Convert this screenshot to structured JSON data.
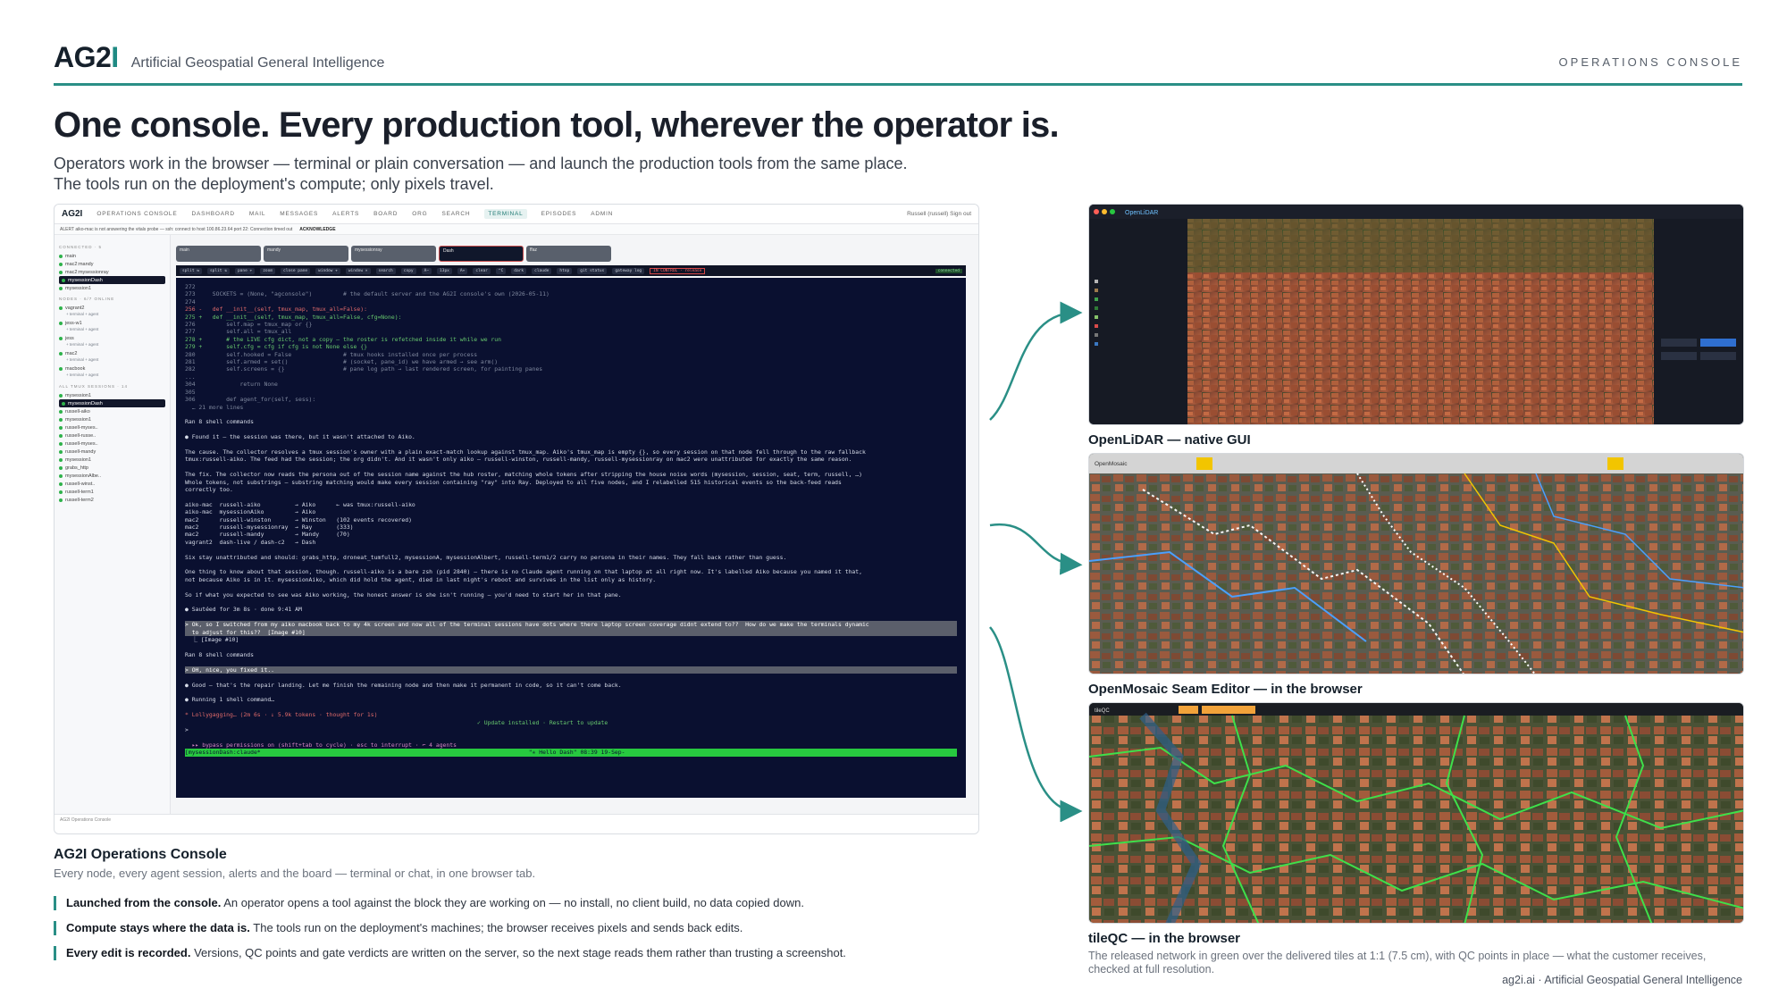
{
  "brand": {
    "logo_main": "AG2",
    "logo_accent": "I",
    "tagline": "Artificial Geospatial General Intelligence",
    "section": "OPERATIONS CONSOLE"
  },
  "headline": "One console. Every production tool, wherever the operator is.",
  "subhead": "Operators work in the browser — terminal or plain conversation — and launch the production tools from the same place. The tools run on the deployment's compute; only pixels travel.",
  "console": {
    "logo": "AG2I",
    "subtitle": "OPERATIONS CONSOLE",
    "nav": [
      "DASHBOARD",
      "MAIL",
      "MESSAGES",
      "ALERTS",
      "BOARD",
      "ORG",
      "SEARCH",
      "TERMINAL",
      "EPISODES",
      "ADMIN"
    ],
    "alert": "ALERT aiko-mac is not answering the vitals probe — ssh: connect to host 100.86.23.64 port 22: Connection timed out",
    "acknowledge": "ACKNOWLEDGE",
    "user": "Russell (russell)  Sign out",
    "sidebar_header": "CONNECTED · 5",
    "sidebar_items": [
      "main",
      "mac2:mandy",
      "mac2:mysessionray",
      "mysessionDash",
      "mysession1"
    ],
    "nodes_header": "NODES · 6/7 ONLINE",
    "nodes": [
      "vagrant2",
      "jess-w1",
      "jess",
      "mac2",
      "macbook"
    ],
    "tmux_header": "ALL TMUX SESSIONS · 14",
    "tmux": [
      "mysession1",
      "mysessionDash",
      "russell-aiko",
      "mysession1",
      "russell-myses..",
      "russell-russe..",
      "russell-myses..",
      "russell-mandy",
      "mysession1",
      "grabs_http",
      "mysessionAlbe..",
      "russell-winst..",
      "russell-term1",
      "russell-term2"
    ],
    "tabs": [
      "main",
      "mandy",
      "mysessionray",
      "Dash",
      "ffaz"
    ],
    "tools": [
      "split ⇆",
      "split ⇅",
      "pane +",
      "zoom",
      "close pane",
      "window +",
      "window ×",
      "search",
      "copy",
      "A−",
      "13px",
      "A+",
      "clear",
      "^C",
      "dark",
      "claude",
      "htop",
      "git status",
      "gateway log"
    ],
    "control": "IN CONTROL · release",
    "connected": "connected",
    "footer": "AG2I  Operations Console"
  },
  "terminal_lines": [
    "272",
    "273     SOCKETS = (None, \"agconsole\")         # the default server and the AG2I console's own (2026-05-11)",
    "274",
    "256 -   def __init__(self, tmux_map, tmux_all=False):",
    "275 +   def __init__(self, tmux_map, tmux_all=False, cfg=None):",
    "276         self.map = tmux_map or {}",
    "277         self.all = tmux_all",
    "278 +       # the LIVE cfg dict, not a copy — the roster is refetched inside it while we run",
    "279 +       self.cfg = cfg if cfg is not None else {}",
    "280         self.hooked = False               # tmux hooks installed once per process",
    "281         self.armed = set()                # (socket, pane_id) we have armed → see arm()",
    "282         self.screens = {}                 # pane log path → last rendered screen, for painting panes",
    "...",
    "304             return None",
    "305",
    "306         def agent_for(self, sess):",
    "  … 21 more lines",
    "",
    "Ran 8 shell commands",
    "",
    "● Found it — the session was there, but it wasn't attached to Aiko.",
    "",
    "The cause. The collector resolves a tmux session's owner with a plain exact-match lookup against tmux_map. Aiko's tmux_map is empty {}, so every session on that node fell through to the raw fallback",
    "tmux:russell-aiko. The feed had the session; the org didn't. And it wasn't only aiko — russell-winston, russell-mandy, russell-mysessionray on mac2 were unattributed for exactly the same reason.",
    "",
    "The fix. The collector now reads the persona out of the session name against the hub roster, matching whole tokens after stripping the house noise words (mysession, session, seat, term, russell, …)",
    "Whole tokens, not substrings — substring matching would make every session containing \"ray\" into Ray. Deployed to all five nodes, and I relabelled 515 historical events so the back-feed reads",
    "correctly too.",
    "",
    "aiko-mac  russell-aiko          → Aiko      ← was tmux:russell-aiko",
    "aiko-mac  mysessionAiko         → Aiko",
    "mac2      russell-winston       → Winston   (102 events recovered)",
    "mac2      russell-mysessionray  → Ray       (333)",
    "mac2      russell-mandy         → Mandy     (70)",
    "vagrant2  dash-live / dash-c2   → Dash",
    "",
    "Six stay unattributed and should: grabs_http, droneat_tumfull2, mysessionA, mysessionAlbert, russell-term1/2 carry no persona in their names. They fall back rather than guess.",
    "",
    "One thing to know about that session, though. russell-aiko is a bare zsh (pid 2840) — there is no Claude agent running on that laptop at all right now. It's labelled Aiko because you named it that,",
    "not because Aiko is in it. mysessionAiko, which did hold the agent, died in last night's reboot and survives in the list only as history.",
    "",
    "So if what you expected to see was Aiko working, the honest answer is she isn't running — you'd need to start her in that pane.",
    "",
    "● Sautéed for 3m 8s · done 9:41 AM",
    "",
    "> Ok, so I switched from my aiko macbook back to my 4k screen and now all of the terminal sessions have dots where there laptop screen coverage didnt extend to??  How do we make the terminals dynamic",
    "  to adjust for this??  [Image #10]",
    "  ⎿ [Image #10]",
    "",
    "Ran 8 shell commands",
    "",
    "> OH, nice, you fixed it..",
    "",
    "● Good — that's the repair landing. Let me finish the remaining node and then make it permanent in code, so it can't come back.",
    "",
    "● Running 1 shell command…",
    "",
    "* Lollygagging… (2m 6s · ↓ 5.9k tokens · thought for 1s)",
    "                                                                                     ✓ Update installed · Restart to update",
    ">",
    "",
    "  ▸▸ bypass permissions on (shift+tab to cycle) · esc to interrupt · ⌐ 4 agents",
    "[mysessionDash:claude*                                                                              \"✳ Hello Dash\" 08:39 19-Sep-"
  ],
  "console_caption": "AG2I Operations Console",
  "console_sub": "Every node, every agent session, alerts and the board — terminal or chat, in one browser tab.",
  "points": [
    {
      "lead": "Launched from the console.",
      "text": "An operator opens a tool against the block they are working on — no install, no client build, no data copied down."
    },
    {
      "lead": "Compute stays where the data is.",
      "text": "The tools run on the deployment's machines; the browser receives pixels and sends back edits."
    },
    {
      "lead": "Every edit is recorded.",
      "text": "Versions, QC points and gate verdicts are written on the server, so the next stage reads them rather than trusting a screenshot."
    }
  ],
  "panels": [
    {
      "caption": "OpenLiDAR — native GUI",
      "app": "OpenLiDAR"
    },
    {
      "caption": "OpenMosaic Seam Editor — in the browser",
      "app": "OpenMosaic"
    },
    {
      "caption": "tileQC — in the browser",
      "app": "tileQC"
    }
  ],
  "tileqc_sub": "The released network in green over the delivered tiles at 1:1 (7.5 cm), with QC points in place — what the customer receives, checked at full resolution.",
  "footer": "ag2i.ai · Artificial Geospatial General Intelligence",
  "colors": {
    "accent": "#2a8f86",
    "terminal_bg": "#0a1030",
    "status_green": "#27c93f"
  }
}
